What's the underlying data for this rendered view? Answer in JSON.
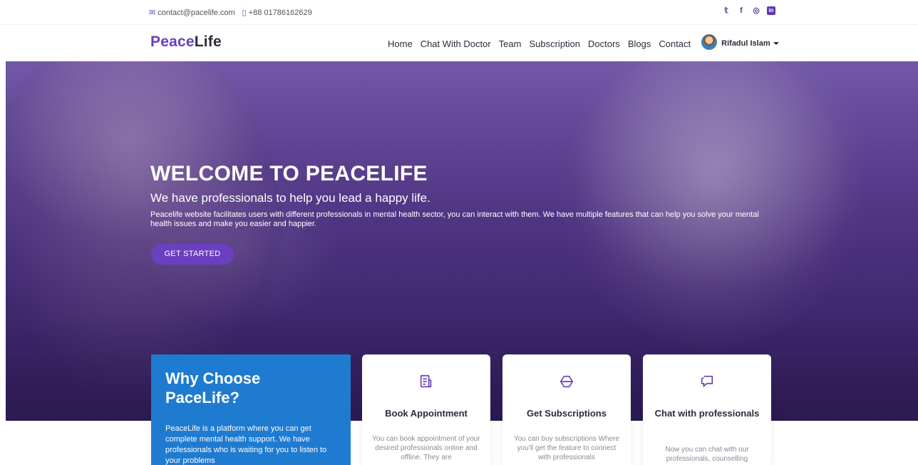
{
  "topbar": {
    "email": "contact@pacelife.com",
    "phone": "+88 01786162629",
    "social": [
      "twitter-icon",
      "facebook-icon",
      "instagram-icon",
      "linkedin-icon"
    ]
  },
  "nav": {
    "logo_a": "Peace",
    "logo_b": "Life",
    "items": [
      "Home",
      "Chat With Doctor",
      "Team",
      "Subscription",
      "Doctors",
      "Blogs",
      "Contact"
    ],
    "user": "Rifadul Islam"
  },
  "hero": {
    "title": "WELCOME TO PEACELIFE",
    "subtitle": "We have professionals to help you lead a happy life.",
    "description": "Peacelife website facilitates users with different professionals in mental health sector, you can interact with them. We have multiple features that can help you solve your mental health issues and make you easier and happier.",
    "cta": "GET STARTED"
  },
  "why": {
    "title": "Why Choose PaceLife?",
    "text": "PeaceLife is a platform where you can get complete mental health support. We have professionals who is waiting for you to listen to your problems"
  },
  "cards": [
    {
      "icon": "document-icon",
      "title": "Book Appointment",
      "desc": "You can book appointment of your desired professionals online and offline. They are"
    },
    {
      "icon": "hexagon-icon",
      "title": "Get Subscriptions",
      "desc": "You can buy subscriptions Where you'll get the feature to connect with professionals"
    },
    {
      "icon": "chat-icon",
      "title": "Chat with professionals",
      "desc": "Now you can chat with our professionals, counselling"
    }
  ],
  "colors": {
    "brand": "#6a3fc0",
    "accent_blue": "#1e7bd0"
  }
}
